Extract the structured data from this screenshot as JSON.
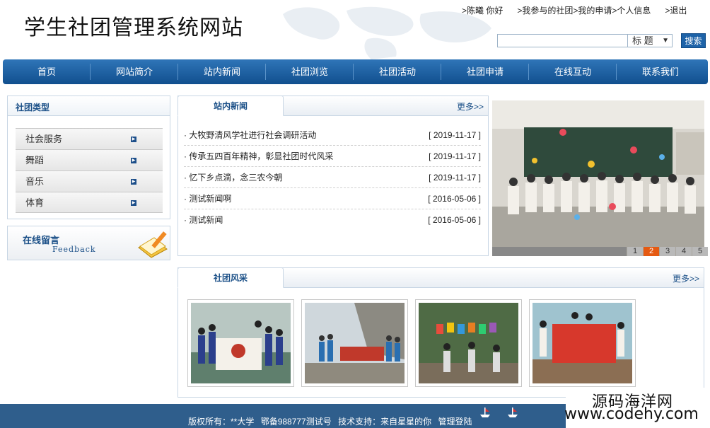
{
  "header": {
    "site_title": "学生社团管理系统网站",
    "user_greeting": ">陈曦 你好",
    "link_my_clubs": ">我参与的社团",
    "link_my_apply": ">我的申请",
    "link_profile": ">个人信息",
    "link_logout": ">退出",
    "search_placeholder": "",
    "search_field_select": "标 题",
    "search_button": "搜索"
  },
  "nav": {
    "items": [
      "首页",
      "网站简介",
      "站内新闻",
      "社团浏览",
      "社团活动",
      "社团申请",
      "在线互动",
      "联系我们"
    ]
  },
  "sidebar": {
    "category_title": "社团类型",
    "categories": [
      "社会服务",
      "舞蹈",
      "音乐",
      "体育"
    ],
    "feedback_title": "在线留言",
    "feedback_sub": "Feedback"
  },
  "news": {
    "tab": "站内新闻",
    "more": "更多>>",
    "items": [
      {
        "title": "· 大牧野清风学社进行社会调研活动",
        "date": "[ 2019-11-17 ]"
      },
      {
        "title": "· 传承五四百年精神，彰显社团时代风采",
        "date": "[ 2019-11-17 ]"
      },
      {
        "title": "· 忆下乡点滴，念三农今朝",
        "date": "[ 2019-11-17 ]"
      },
      {
        "title": "· 测试新闻啊",
        "date": "[ 2016-05-06 ]"
      },
      {
        "title": "· 测试新闻",
        "date": "[ 2016-05-06 ]"
      }
    ]
  },
  "slideshow": {
    "pages": [
      "1",
      "2",
      "3",
      "4",
      "5"
    ],
    "active_page": "2"
  },
  "club_style": {
    "tab": "社团风采",
    "more": "更多>>"
  },
  "footer": {
    "copyright": "版权所有：**大学",
    "icp": "鄂备988777测试号",
    "support": "技术支持：来自星星的你",
    "admin_login": "管理登陆"
  },
  "watermark": {
    "cn": "源码海洋网",
    "url": "www.codehy.com"
  },
  "colors": {
    "nav": "#1a5d9f",
    "accent_text": "#1a4f87",
    "active_dot": "#e55a12",
    "footer": "#2f5e8c"
  }
}
